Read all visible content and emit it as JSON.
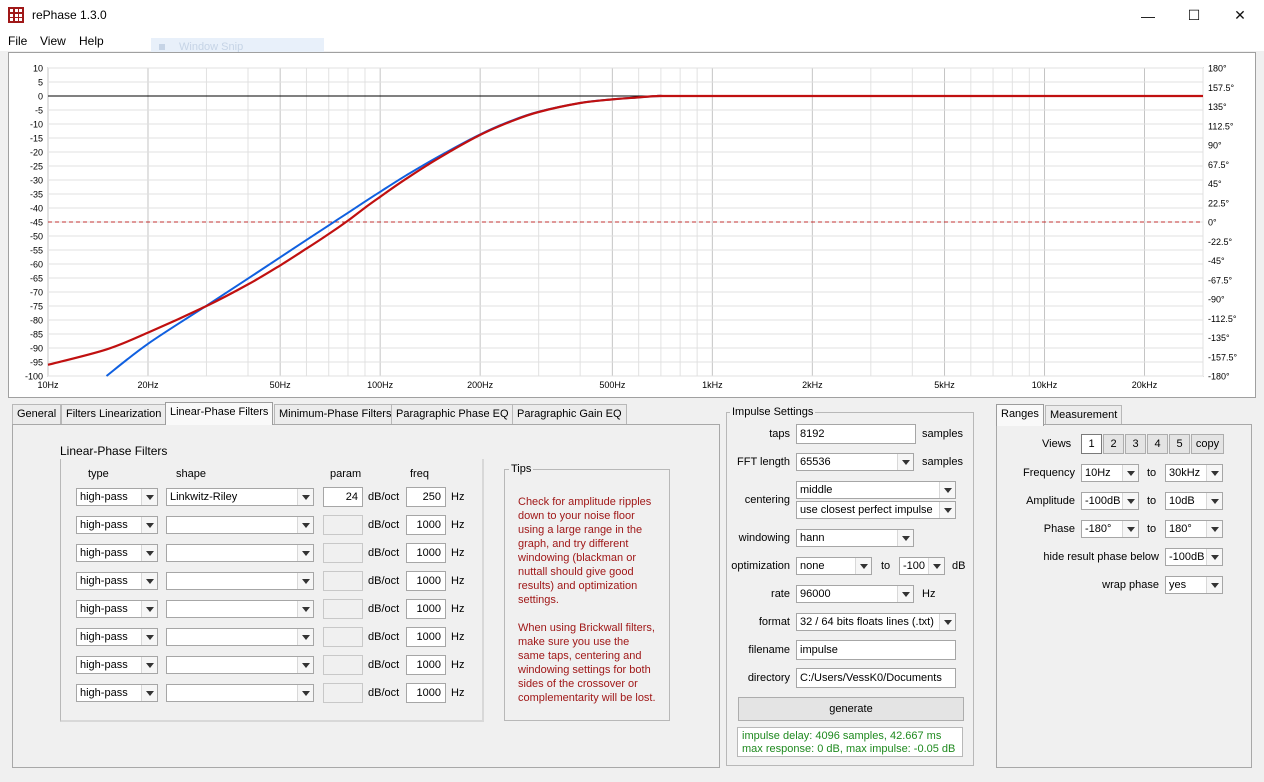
{
  "window": {
    "title": "rePhase 1.3.0",
    "minimize": "—",
    "maximize": "☐",
    "close": "✕"
  },
  "menu": {
    "items": [
      "File",
      "View",
      "Help"
    ],
    "ghost_tooltip": "Window Snip"
  },
  "chart_data": {
    "type": "line",
    "x_scale": "log",
    "xlim": [
      10,
      30000
    ],
    "x_ticks": [
      10,
      20,
      50,
      100,
      200,
      500,
      1000,
      2000,
      5000,
      10000,
      20000
    ],
    "x_tick_labels": [
      "10Hz",
      "20Hz",
      "50Hz",
      "100Hz",
      "200Hz",
      "500Hz",
      "1kHz",
      "2kHz",
      "5kHz",
      "10kHz",
      "20kHz"
    ],
    "ylim": [
      -100,
      10
    ],
    "y_tick_labels": [
      "10",
      "5",
      "0",
      "-5",
      "-10",
      "-15",
      "-20",
      "-25",
      "-30",
      "-35",
      "-40",
      "-45",
      "-50",
      "-55",
      "-60",
      "-65",
      "-70",
      "-75",
      "-80",
      "-85",
      "-90",
      "-95",
      "-100"
    ],
    "y2_tick_labels": [
      "180°",
      "157.5°",
      "135°",
      "112.5°",
      "90°",
      "67.5°",
      "45°",
      "22.5°",
      "0°",
      "-22.5°",
      "-45°",
      "-67.5°",
      "-90°",
      "-112.5°",
      "-135°",
      "-157.5°",
      "-180°"
    ],
    "grid": true,
    "reference_lines": [
      {
        "y": 0,
        "style": "solid",
        "color": "#000000"
      },
      {
        "y": -45,
        "style": "dashed",
        "color": "#c03030"
      }
    ],
    "series": [
      {
        "color": "#1060e0",
        "x": [
          15,
          20,
          30,
          40,
          50,
          60,
          70,
          80,
          90,
          100,
          120,
          150,
          200,
          250,
          300,
          400,
          500,
          600,
          700,
          1000,
          30000
        ],
        "values": [
          -100,
          -88.5,
          -74.9,
          -65.2,
          -57.6,
          -51.4,
          -46.2,
          -41.7,
          -37.7,
          -34.2,
          -28.3,
          -21.6,
          -13.7,
          -8.7,
          -5.6,
          -2.5,
          -1.2,
          -0.5,
          0,
          0,
          0
        ]
      },
      {
        "color": "#c01010",
        "x": [
          10,
          15,
          20,
          30,
          40,
          50,
          60,
          70,
          80,
          90,
          100,
          120,
          150,
          200,
          250,
          300,
          400,
          500,
          600,
          700,
          1000,
          30000
        ],
        "values": [
          -96,
          -90.5,
          -84.5,
          -75,
          -67.3,
          -60.5,
          -54.5,
          -49.3,
          -44.5,
          -39.9,
          -36,
          -29.5,
          -22.2,
          -13.9,
          -8.9,
          -5.7,
          -2.5,
          -1.2,
          -0.5,
          0,
          0,
          0
        ]
      }
    ]
  },
  "tabs": [
    "General",
    "Filters Linearization",
    "Linear-Phase Filters",
    "Minimum-Phase Filters",
    "Paragraphic Phase EQ",
    "Paragraphic Gain EQ"
  ],
  "active_tab": "Linear-Phase Filters",
  "lpf": {
    "title": "Linear-Phase Filters",
    "headers": {
      "type": "type",
      "shape": "shape",
      "param": "param",
      "freq": "freq"
    },
    "unit_param": "dB/oct",
    "unit_freq": "Hz",
    "rows": [
      {
        "type": "high-pass",
        "shape": "Linkwitz-Riley",
        "param": "24",
        "freq": "250"
      },
      {
        "type": "high-pass",
        "shape": "",
        "param": "",
        "freq": "1000"
      },
      {
        "type": "high-pass",
        "shape": "",
        "param": "",
        "freq": "1000"
      },
      {
        "type": "high-pass",
        "shape": "",
        "param": "",
        "freq": "1000"
      },
      {
        "type": "high-pass",
        "shape": "",
        "param": "",
        "freq": "1000"
      },
      {
        "type": "high-pass",
        "shape": "",
        "param": "",
        "freq": "1000"
      },
      {
        "type": "high-pass",
        "shape": "",
        "param": "",
        "freq": "1000"
      },
      {
        "type": "high-pass",
        "shape": "",
        "param": "",
        "freq": "1000"
      }
    ]
  },
  "tips": {
    "title": "Tips",
    "lines": [
      "Check for amplitude ripples",
      "down to your noise floor",
      "using a large range in the",
      "graph, and try different",
      "windowing (blackman or",
      "nuttall should give good",
      "results) and optimization",
      "settings.",
      "",
      "When using Brickwall filters,",
      "make sure you use the",
      "same taps, centering and",
      "windowing settings for both",
      "sides of the crossover or",
      "complementarity will be lost."
    ]
  },
  "impulse": {
    "title": "Impulse Settings",
    "taps_label": "taps",
    "taps": "8192",
    "samples": "samples",
    "fft_label": "FFT length",
    "fft": "65536",
    "centering_label": "centering",
    "centering": "middle",
    "centering2": "use closest perfect impulse",
    "windowing_label": "windowing",
    "windowing": "hann",
    "optimization_label": "optimization",
    "optimization": "none",
    "to": "to",
    "opt_db": "-100",
    "db": "dB",
    "rate_label": "rate",
    "rate": "96000",
    "hz": "Hz",
    "format_label": "format",
    "format": "32 / 64 bits floats lines (.txt)",
    "filename_label": "filename",
    "filename": "impulse",
    "directory_label": "directory",
    "directory": "C:/Users/VessK0/Documents",
    "generate": "generate",
    "status1": "impulse delay: 4096 samples, 42.667 ms",
    "status2": "max response: 0 dB, max impulse: -0.05 dB"
  },
  "ranges": {
    "tabs": [
      "Ranges",
      "Measurement"
    ],
    "views_label": "Views",
    "views": [
      "1",
      "2",
      "3",
      "4",
      "5",
      "copy"
    ],
    "frequency_label": "Frequency",
    "freq_from": "10Hz",
    "freq_to": "30kHz",
    "amplitude_label": "Amplitude",
    "amp_from": "-100dB",
    "amp_to": "10dB",
    "phase_label": "Phase",
    "phase_from": "-180°",
    "phase_to": "180°",
    "hide_label": "hide result phase below",
    "hide_value": "-100dB",
    "wrap_label": "wrap phase",
    "wrap_value": "yes",
    "to": "to"
  }
}
